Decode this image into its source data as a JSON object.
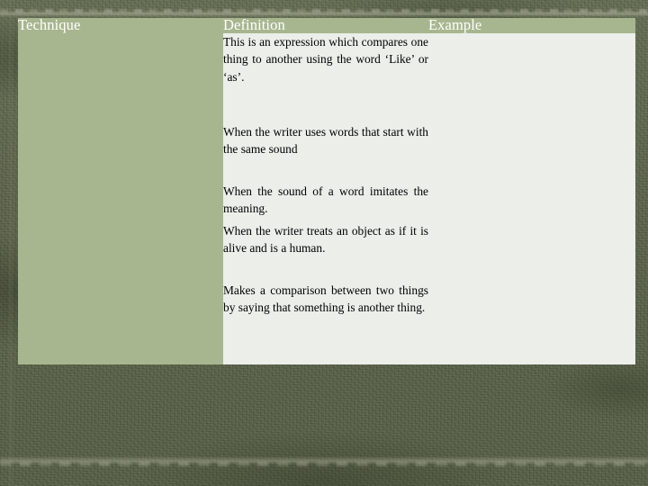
{
  "slide": {
    "background_color": "#5a6349",
    "accent_color": "#a8b68f",
    "cell_color": "#eceeea",
    "border_color": "#ffffff",
    "header_text_color": "#ffffff"
  },
  "table": {
    "headers": [
      {
        "label": "Technique"
      },
      {
        "label": "Definition"
      },
      {
        "label": "Example"
      }
    ],
    "rows": [
      {
        "technique": "",
        "definition": "This is an expression which compares one thing to another using the word ‘Like’ or ‘as’.",
        "example": ""
      },
      {
        "technique": "",
        "definition": "When the writer uses words that start with the same sound",
        "example": ""
      },
      {
        "technique": "",
        "definition": "When the sound of a word imitates the meaning.",
        "example": ""
      },
      {
        "technique": "",
        "definition": "When the writer treats an object as if it is alive and is a human.",
        "example": ""
      },
      {
        "technique": "",
        "definition": "Makes a comparison between two things by saying that something is another thing.",
        "example": ""
      }
    ]
  }
}
